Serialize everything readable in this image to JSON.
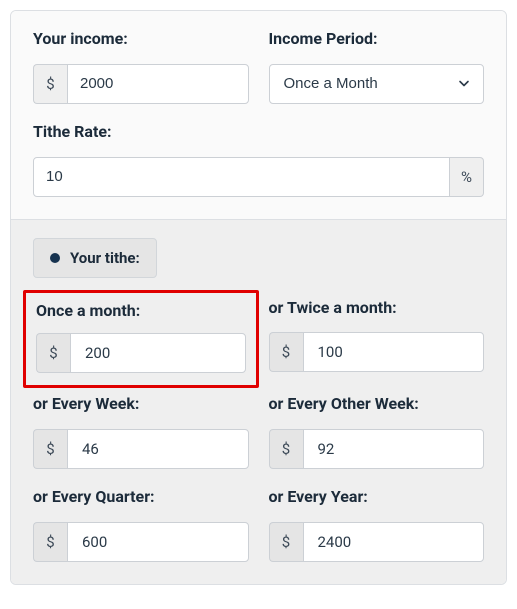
{
  "inputs": {
    "income_label": "Your income:",
    "income_value": "2000",
    "period_label": "Income Period:",
    "period_value": "Once a Month",
    "rate_label": "Tithe Rate:",
    "rate_value": "10",
    "currency_symbol": "$",
    "percent_symbol": "%"
  },
  "tithe_chip": "Your tithe:",
  "results": {
    "monthly_label": "Once a month:",
    "monthly_value": "200",
    "twice_monthly_label": "or Twice a month:",
    "twice_monthly_value": "100",
    "weekly_label": "or Every Week:",
    "weekly_value": "46",
    "biweekly_label": "or Every Other Week:",
    "biweekly_value": "92",
    "quarterly_label": "or Every Quarter:",
    "quarterly_value": "600",
    "yearly_label": "or Every Year:",
    "yearly_value": "2400"
  }
}
